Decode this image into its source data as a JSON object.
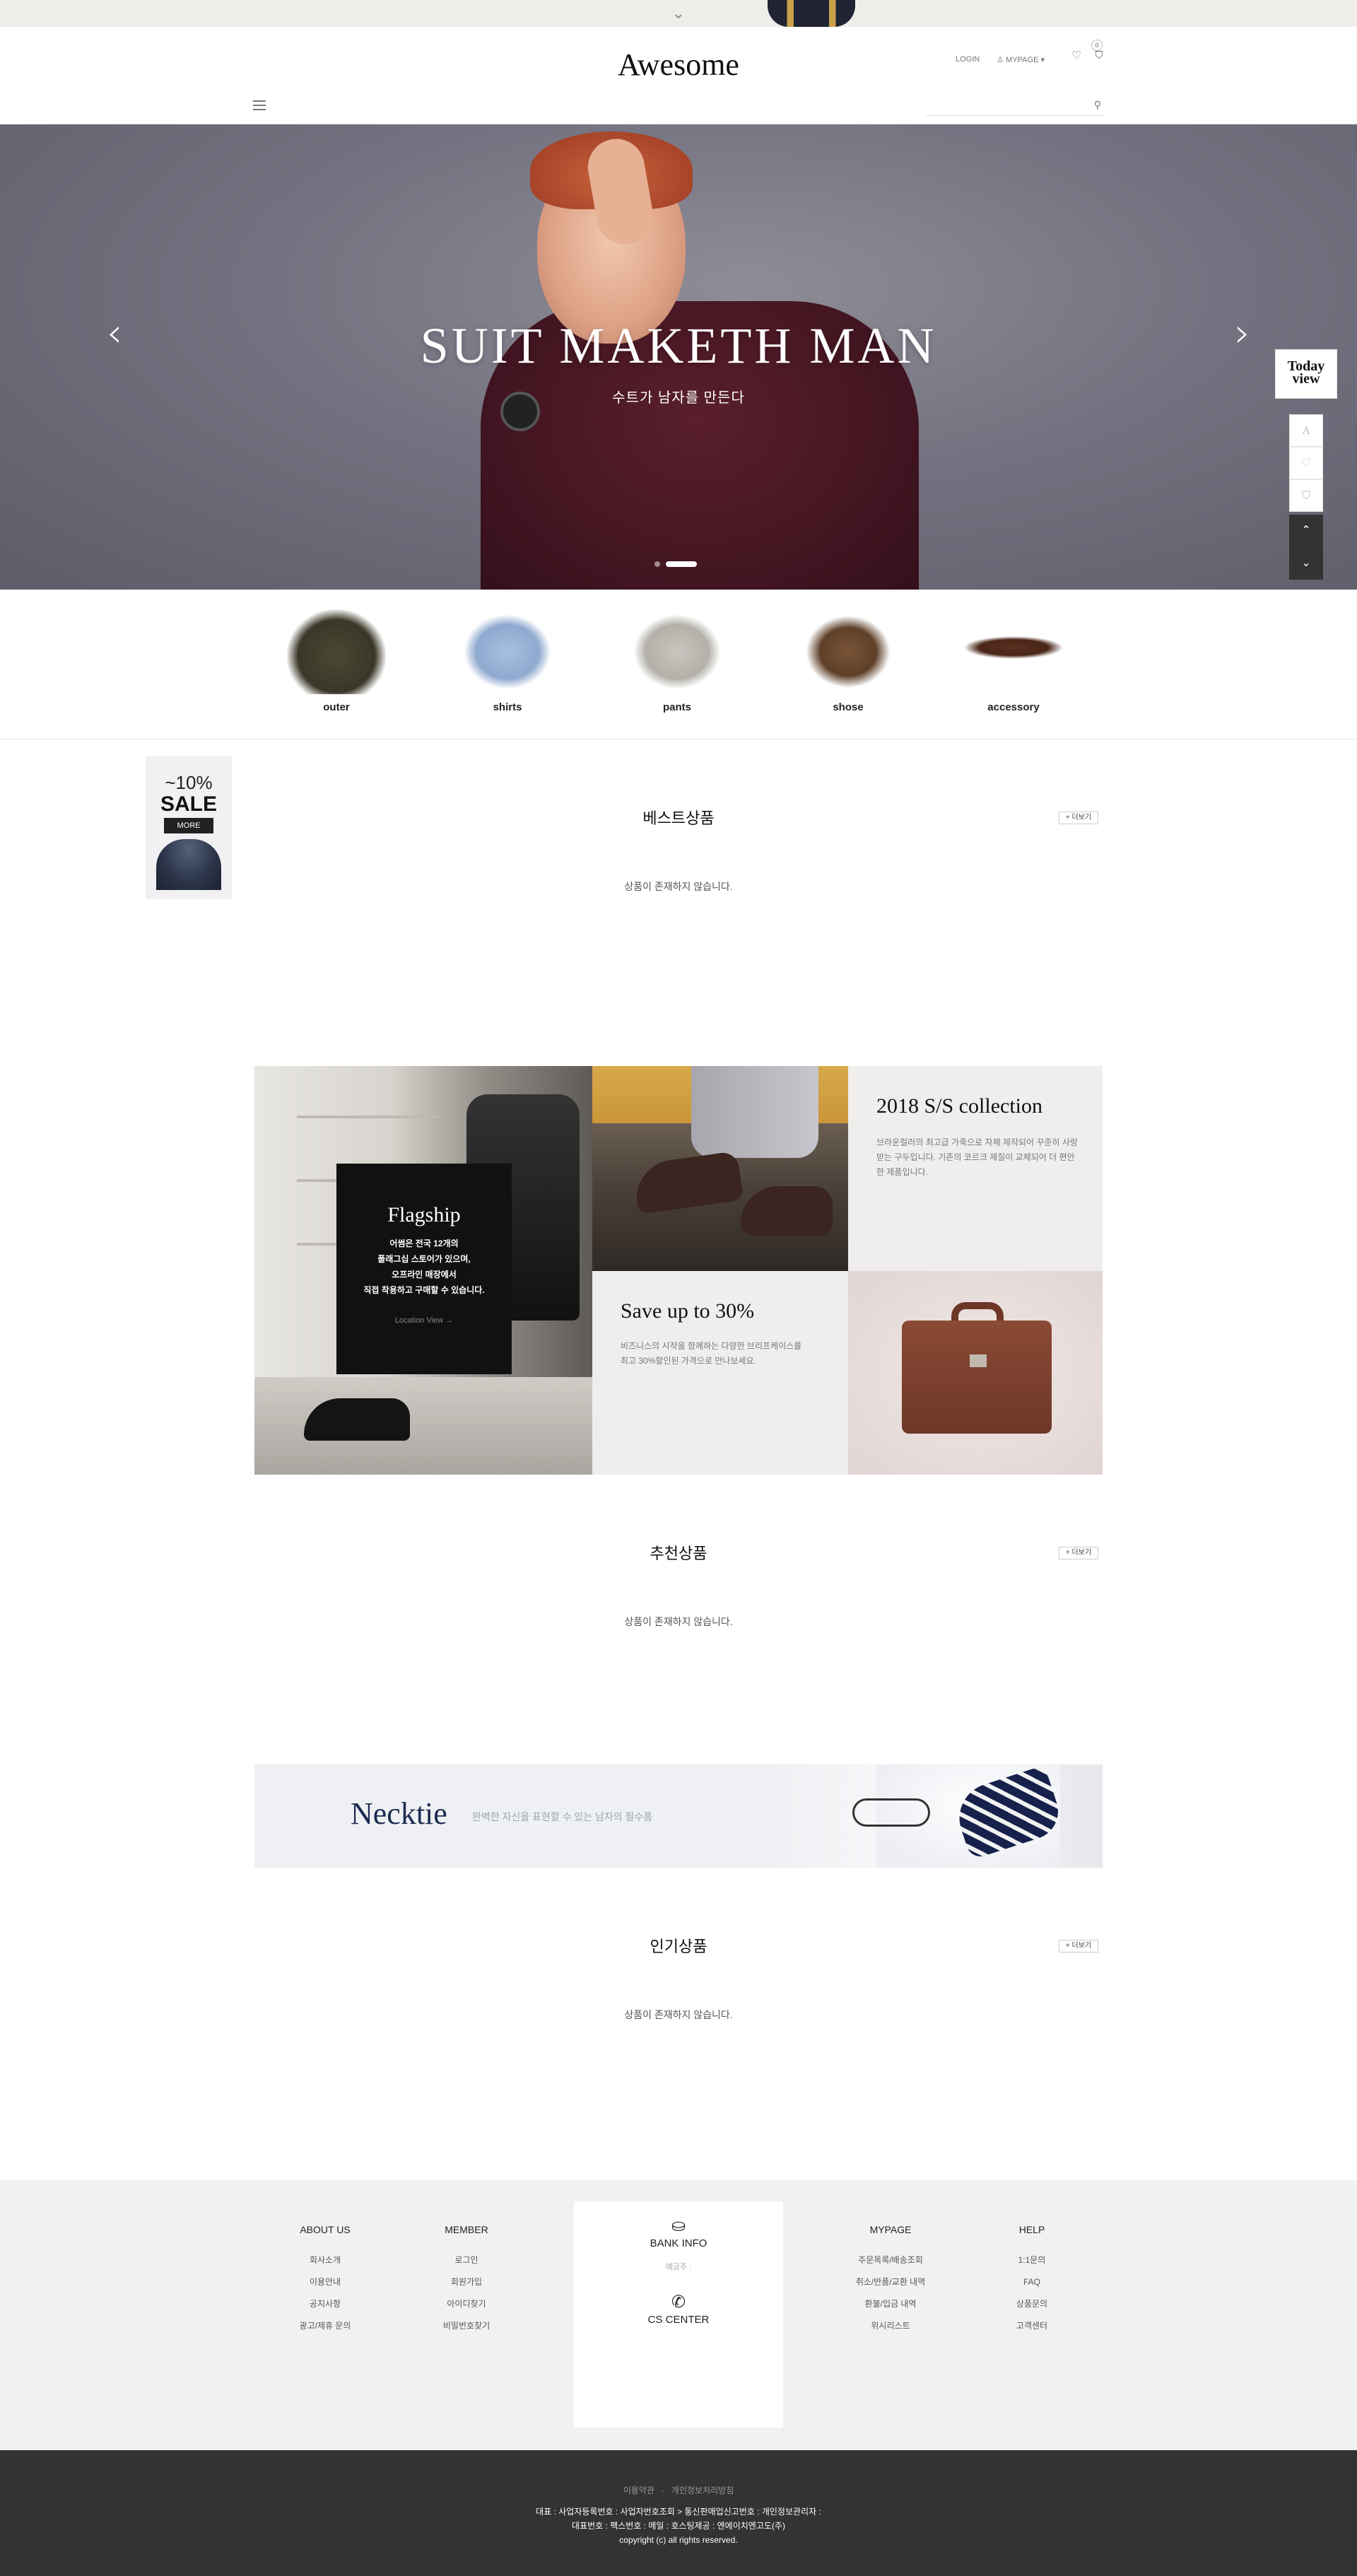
{
  "header": {
    "logo": "Awesome",
    "login": "LOGIN",
    "mypage": "MYPAGE",
    "cart_count": "0",
    "search_placeholder": ""
  },
  "hero": {
    "title": "SUIT MAKETH MAN",
    "subtitle": "수트가 남자를 만든다"
  },
  "today_view": "Today view",
  "categories": [
    {
      "label": "outer"
    },
    {
      "label": "shirts"
    },
    {
      "label": "pants"
    },
    {
      "label": "shose"
    },
    {
      "label": "accessory"
    }
  ],
  "sale_banner": {
    "percent": "~10%",
    "label": "SALE",
    "button": "MORE"
  },
  "sections": {
    "best": {
      "title": "베스트상품",
      "more": "+ 더보기",
      "empty": "상품이 존재하지 않습니다."
    },
    "recommend": {
      "title": "추천상품",
      "more": "+ 더보기",
      "empty": "상품이 존재하지 않습니다."
    },
    "popular": {
      "title": "인기상품",
      "more": "+ 더보기",
      "empty": "상품이 존재하지 않습니다."
    }
  },
  "promo_grid": {
    "flagship_title": "Flagship",
    "flagship_desc_1": "어썸은 전국 12개의",
    "flagship_desc_2": "플래그십 스토어가 있으며,",
    "flagship_desc_3": "오프라인 매장에서",
    "flagship_desc_4": "직접 착용하고 구매할 수 있습니다.",
    "flagship_link": "Location View →",
    "collection_title": "2018 S/S collection",
    "collection_desc": "브라운컬러의 최고급 가죽으로 자체 제작되어 꾸준히 사랑받는 구두입니다. 기존의 코르크 제질이 교체되어 더 편안한 제품입니다.",
    "save_title": "Save up to 30%",
    "save_desc": "비즈니스의 시작을 함께하는 다양한 브리프케이스를 최고 30%할인된 가격으로 만나보세요."
  },
  "necktie": {
    "title": "Necktie",
    "desc": "완벽한 자신을 표현할 수 있는 남자의 필수품"
  },
  "footer": {
    "about": {
      "title": "ABOUT US",
      "items": [
        "회사소개",
        "이용안내",
        "공지사항",
        "광고/제휴 문의"
      ]
    },
    "member": {
      "title": "MEMBER",
      "items": [
        "로그인",
        "회원가입",
        "아이디찾기",
        "비밀번호찾기"
      ]
    },
    "bank": {
      "title": "BANK INFO",
      "holder": "예금주 :"
    },
    "cs": {
      "title": "CS CENTER"
    },
    "mypage": {
      "title": "MYPAGE",
      "items": [
        "주문목록/배송조회",
        "취소/반품/교환 내역",
        "환불/입금 내역",
        "위시리스트"
      ]
    },
    "help": {
      "title": "HELP",
      "items": [
        "1:1문의",
        "FAQ",
        "상품문의",
        "고객센터"
      ]
    }
  },
  "copyright": {
    "terms": "이용약관",
    "privacy": "개인정보처리방침",
    "line1": "대표 :    사업자등록번호 : 사업자번호조회 >   통신판매업신고번호 :   개인정보관리자 :",
    "line2": "대표번호 :    팩스번호 :    메일 :    호스팅제공 : 엔에이치엔고도(주)",
    "line3": "copyright (c)  all rights reserved."
  }
}
